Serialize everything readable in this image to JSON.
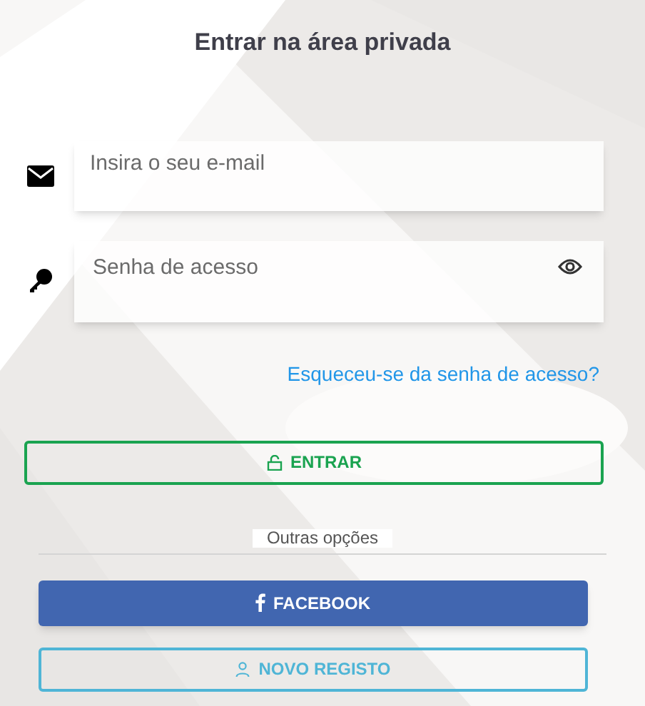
{
  "title": "Entrar na área privada",
  "email_field": {
    "placeholder": "Insira o seu e-mail"
  },
  "password_field": {
    "placeholder": "Senha de acesso"
  },
  "forgot_link": "Esqueceu-se da senha de acesso?",
  "login_button": "ENTRAR",
  "divider_label": "Outras opções",
  "facebook_button": "FACEBOOK",
  "register_button": "NOVO REGISTO"
}
